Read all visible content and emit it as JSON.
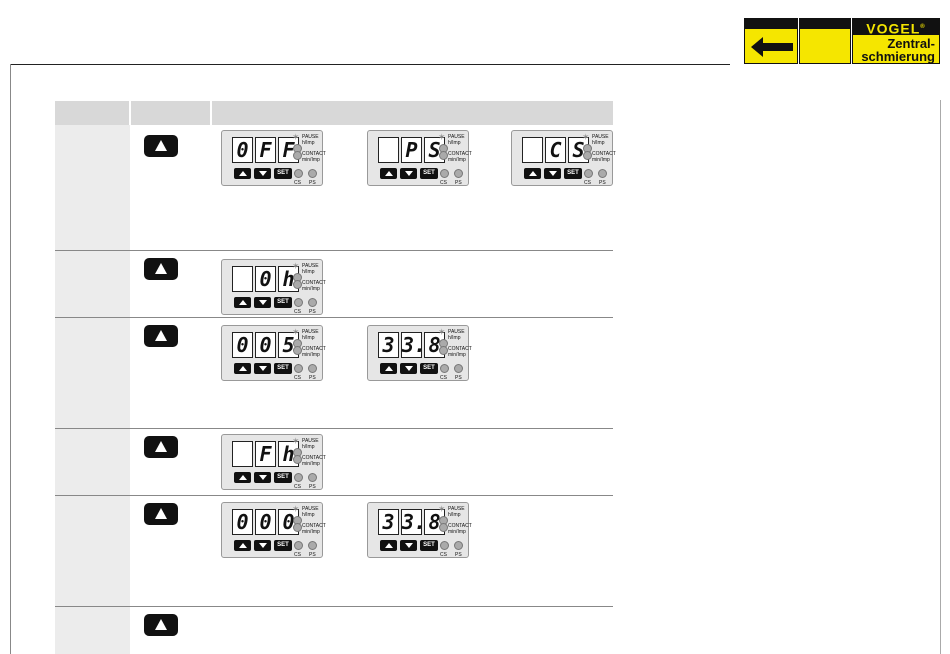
{
  "logo": {
    "brand": "VOGEL",
    "reg": "®",
    "line1": "Zentral-",
    "line2": "schmierung"
  },
  "icons": {
    "back": "arrow-left-icon",
    "up": "up-arrow-icon"
  },
  "panel_labels": {
    "pause": "PAUSE",
    "pause_unit": "h/Imp",
    "contact": "CONTACT",
    "contact_unit": "min/Imp",
    "cs": "CS",
    "ps": "PS",
    "set": "SET"
  },
  "rows": [
    {
      "panels": [
        {
          "digits": [
            "0",
            "F",
            "F"
          ]
        },
        {
          "digits": [
            "",
            "P",
            "S"
          ]
        },
        {
          "digits": [
            "",
            "C",
            "S"
          ]
        }
      ]
    },
    {
      "panels": [
        {
          "digits": [
            "",
            "0",
            "h"
          ]
        }
      ]
    },
    {
      "panels": [
        {
          "digits": [
            "0",
            "0",
            "5"
          ]
        },
        {
          "digits": [
            "3",
            "3.",
            "8"
          ]
        }
      ]
    },
    {
      "panels": [
        {
          "digits": [
            "",
            "F",
            "h"
          ]
        }
      ]
    },
    {
      "panels": [
        {
          "digits": [
            "0",
            "0",
            "0"
          ]
        },
        {
          "digits": [
            "3",
            "3.",
            "8"
          ]
        }
      ]
    },
    {
      "panels": []
    }
  ]
}
